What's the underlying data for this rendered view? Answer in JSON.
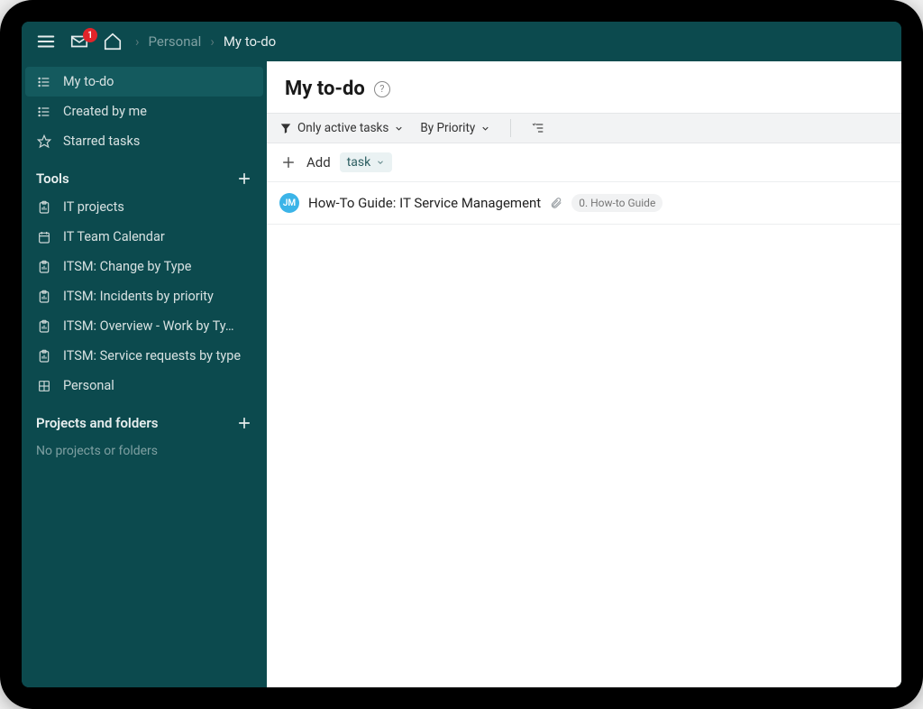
{
  "topbar": {
    "inbox_badge": "1",
    "breadcrumb": {
      "parent": "Personal",
      "current": "My to-do"
    }
  },
  "sidebar": {
    "pinned": [
      {
        "icon": "list-icon",
        "label": "My to-do",
        "active": true
      },
      {
        "icon": "list-icon",
        "label": "Created by me",
        "active": false
      },
      {
        "icon": "star-icon",
        "label": "Starred tasks",
        "active": false
      }
    ],
    "tools_header": "Tools",
    "tools": [
      {
        "icon": "report-icon",
        "label": "IT projects"
      },
      {
        "icon": "calendar-icon",
        "label": "IT Team Calendar"
      },
      {
        "icon": "report-icon",
        "label": "ITSM: Change by Type"
      },
      {
        "icon": "report-icon",
        "label": "ITSM: Incidents by priority"
      },
      {
        "icon": "report-icon",
        "label": "ITSM: Overview - Work by Ty…"
      },
      {
        "icon": "report-icon",
        "label": "ITSM: Service requests by type"
      },
      {
        "icon": "grid-icon",
        "label": "Personal"
      }
    ],
    "projects_header": "Projects and folders",
    "projects_empty": "No projects or folders"
  },
  "main": {
    "title": "My to-do",
    "filter_active": "Only active tasks",
    "sort_by": "By Priority",
    "add_label": "Add",
    "add_chip": "task",
    "tasks": [
      {
        "avatar_initials": "JM",
        "avatar_color": "#3bb4e8",
        "title": "How-To Guide: IT Service Management",
        "has_attachment": true,
        "tag": "0. How-to Guide"
      }
    ]
  }
}
